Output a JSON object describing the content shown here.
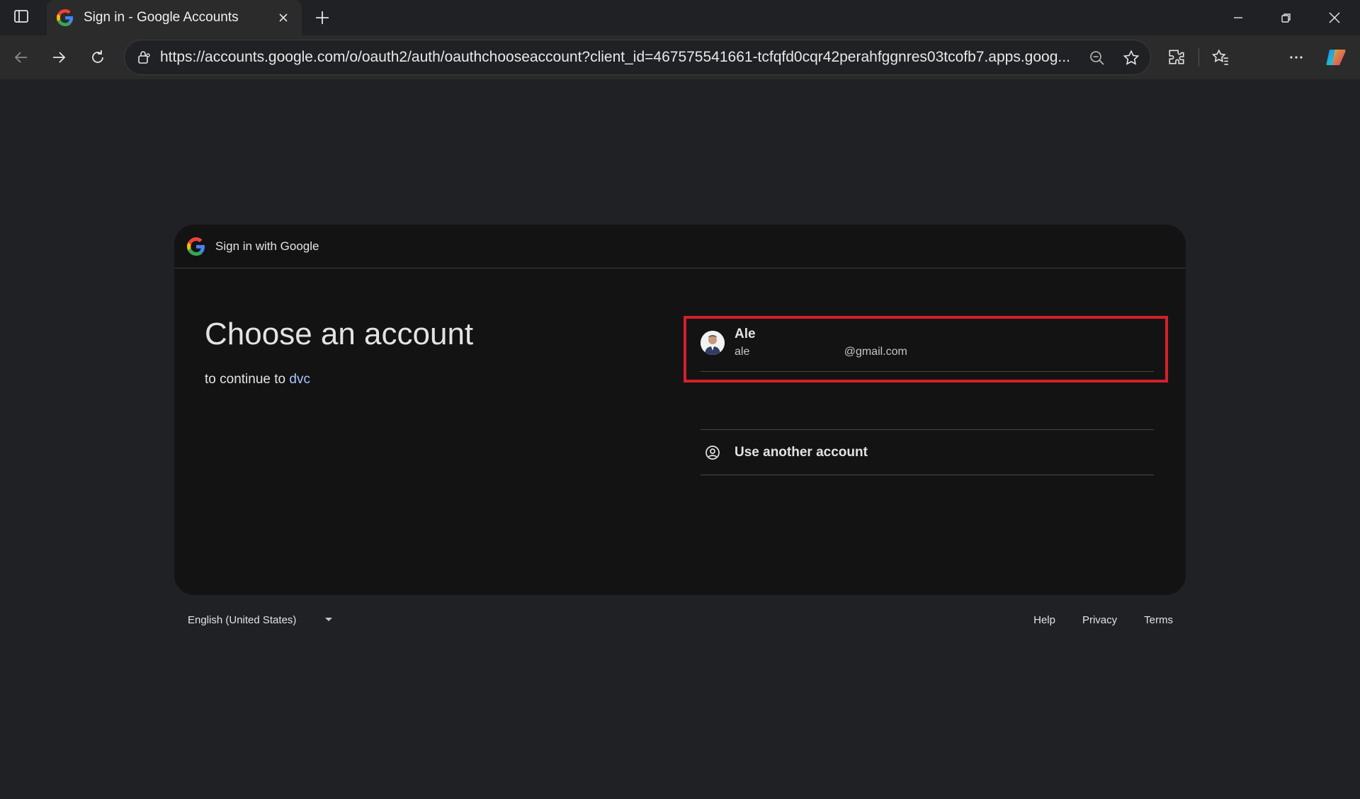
{
  "browser": {
    "tab_title": "Sign in - Google Accounts",
    "url": "https://accounts.google.com/o/oauth2/auth/oauthchooseaccount?client_id=467575541661-tcfqfd0cqr42perahfggnres03tcofb7.apps.goog..."
  },
  "card": {
    "brand": "Sign in with Google",
    "heading": "Choose an account",
    "subtitle_prefix": "to continue to ",
    "app_name": "dvc"
  },
  "accounts": [
    {
      "name": "Ale",
      "email": "ale                              @gmail.com"
    }
  ],
  "use_another": "Use another account",
  "footer": {
    "language": "English (United States)",
    "help": "Help",
    "privacy": "Privacy",
    "terms": "Terms"
  },
  "colors": {
    "highlight": "#d61f2a",
    "link": "#a8c7fa"
  }
}
